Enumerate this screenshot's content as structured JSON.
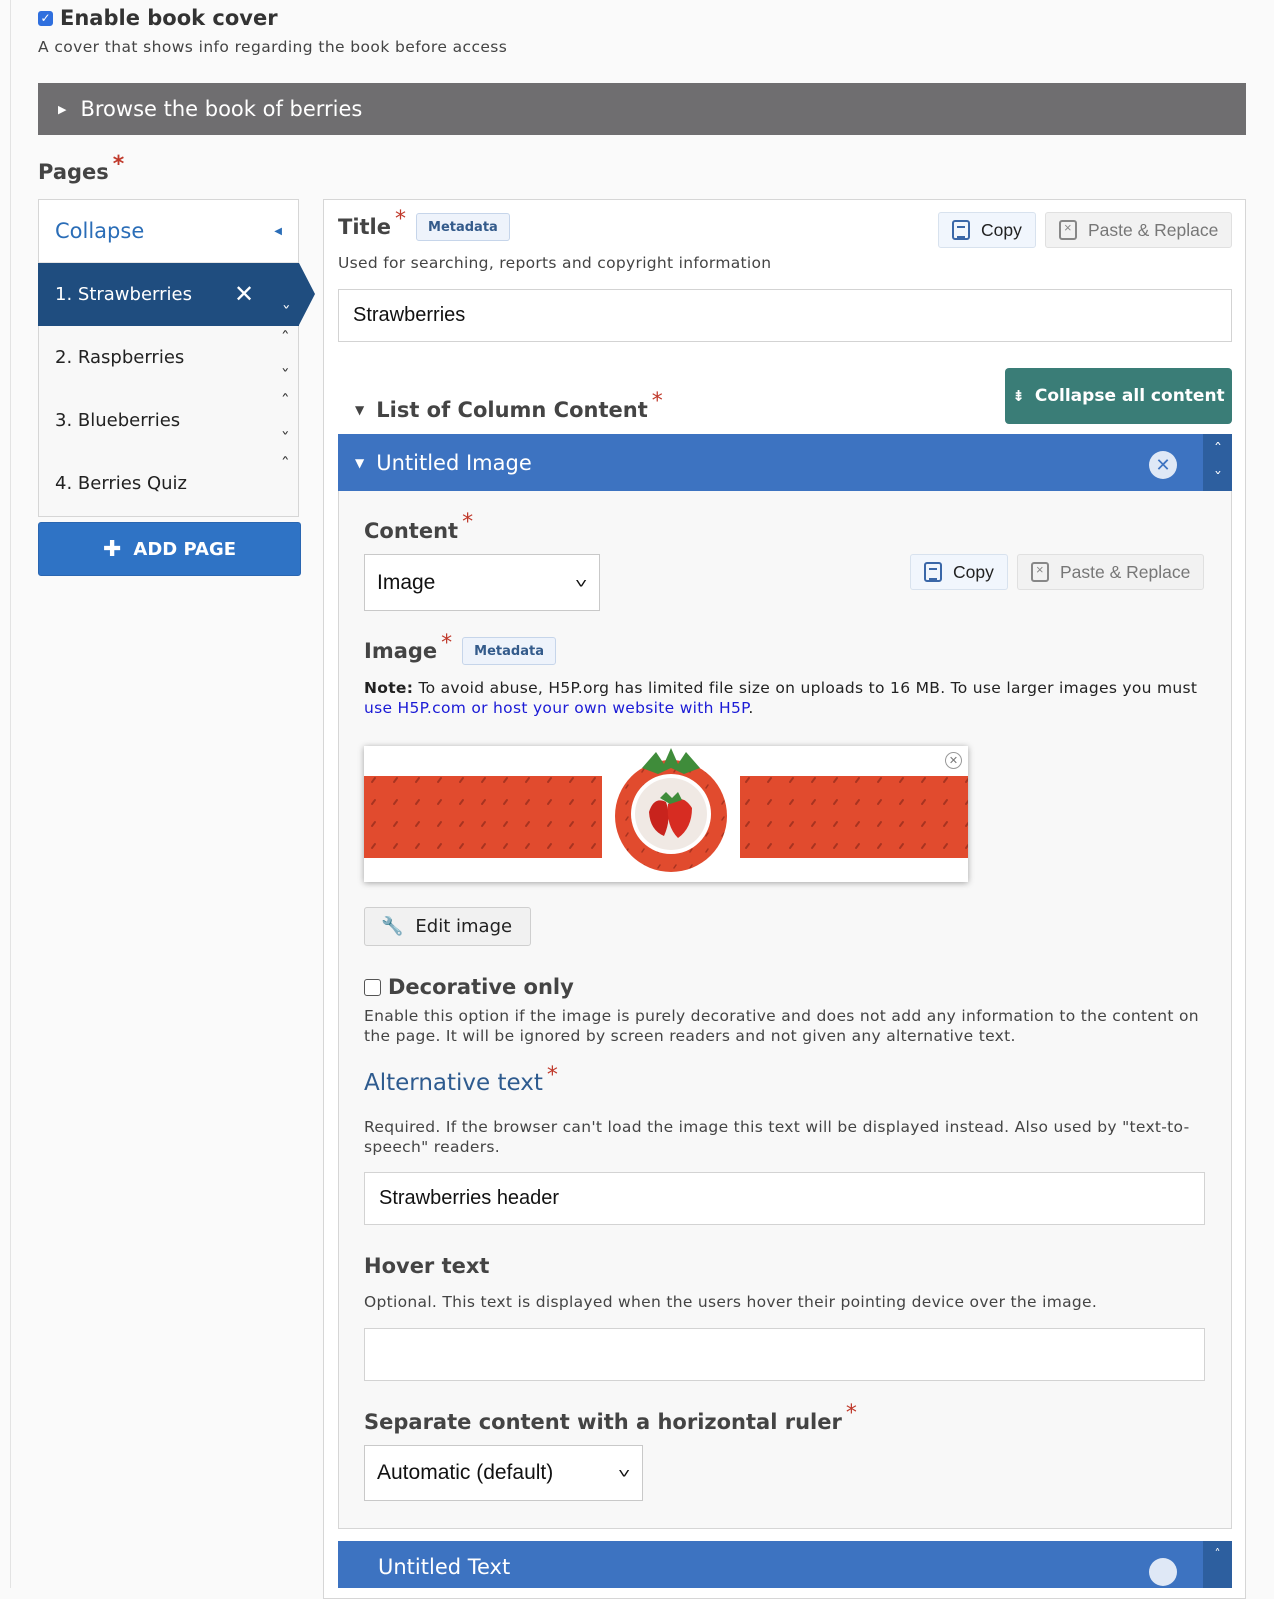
{
  "book_cover": {
    "label": "Enable book cover",
    "checked": true,
    "description": "A cover that shows info regarding the book before access"
  },
  "browse_bar": {
    "label": "Browse the book of berries"
  },
  "pages": {
    "label": "Pages",
    "required_mark": "*",
    "collapse_label": "Collapse",
    "items": [
      {
        "label": "1. Strawberries",
        "active": true
      },
      {
        "label": "2. Raspberries",
        "active": false
      },
      {
        "label": "3. Blueberries",
        "active": false
      },
      {
        "label": "4. Berries Quiz",
        "active": false
      }
    ],
    "add_page_label": "ADD PAGE"
  },
  "title_field": {
    "label": "Title",
    "required_mark": "*",
    "metadata_label": "Metadata",
    "copy_label": "Copy",
    "paste_label": "Paste & Replace",
    "description": "Used for searching, reports and copyright information",
    "value": "Strawberries"
  },
  "column_content": {
    "label": "List of Column Content",
    "required_mark": "*",
    "collapse_all_label": "Collapse all content",
    "group_title": "Untitled Image",
    "next_group_title": "Untitled Text"
  },
  "content_field": {
    "label": "Content",
    "required_mark": "*",
    "selected": "Image",
    "copy_label": "Copy",
    "paste_label": "Paste & Replace"
  },
  "image_field": {
    "label": "Image",
    "required_mark": "*",
    "metadata_label": "Metadata",
    "note_bold": "Note:",
    "note_text": " To avoid abuse, H5P.org has limited file size on uploads to 16 MB. To use larger images you must ",
    "note_link": "use H5P.com or host your own website with H5P",
    "note_end": ".",
    "edit_label": "Edit image",
    "colors": {
      "banner": "#e14b2e",
      "leaf": "#3f8c3a"
    }
  },
  "decorative": {
    "label": "Decorative only",
    "checked": false,
    "description": "Enable this option if the image is purely decorative and does not add any information to the content on the page. It will be ignored by screen readers and not given any alternative text."
  },
  "alt_text": {
    "label": "Alternative text",
    "required_mark": "*",
    "description": "Required. If the browser can't load the image this text will be displayed instead. Also used by \"text-to-speech\" readers.",
    "value": "Strawberries header"
  },
  "hover_text": {
    "label": "Hover text",
    "description": "Optional. This text is displayed when the users hover their pointing device over the image.",
    "value": ""
  },
  "separator": {
    "label": "Separate content with a horizontal ruler",
    "required_mark": "*",
    "selected": "Automatic (default)"
  },
  "accent_colors": {
    "primary_blue": "#3d73c1",
    "nav_active": "#1f4d7f",
    "teal_button": "#3a7d77",
    "required_red": "#c0392b"
  }
}
